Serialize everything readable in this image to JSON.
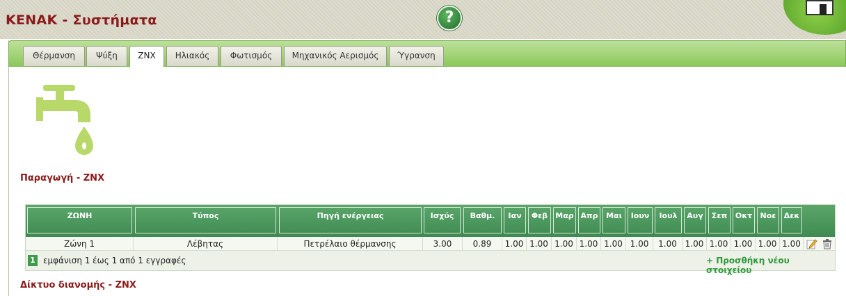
{
  "app": {
    "title": "KENAK - Συστήματα",
    "help_symbol": "?"
  },
  "tabs": [
    {
      "label": "Θέρμανση",
      "active": false
    },
    {
      "label": "Ψύξη",
      "active": false
    },
    {
      "label": "ZNX",
      "active": true
    },
    {
      "label": "Ηλιακός",
      "active": false
    },
    {
      "label": "Φωτισμός",
      "active": false
    },
    {
      "label": "Μηχανικός Αερισμός",
      "active": false
    },
    {
      "label": "Ύγρανση",
      "active": false
    }
  ],
  "section_production": "Παραγωγή - ZNX",
  "section_network": "Δίκτυο διανομής - ZNX",
  "table": {
    "headers": [
      "ΖΩΝΗ",
      "Τύπος",
      "Πηγή ενέργειας",
      "Ισχύς",
      "Βαθμ.",
      "Ιαν",
      "Φεβ",
      "Μαρ",
      "Απρ",
      "Μαι",
      "Ιουν",
      "Ιουλ",
      "Αυγ",
      "Σεπ",
      "Οκτ",
      "Νοε",
      "Δεκ"
    ],
    "rows": [
      [
        "Ζώνη 1",
        "Λέβητας",
        "Πετρέλαιο θέρμανσης",
        "3.00",
        "0.89",
        "1.00",
        "1.00",
        "1.00",
        "1.00",
        "1.00",
        "1.00",
        "1.00",
        "1.00",
        "1.00",
        "1.00",
        "1.00",
        "1.00"
      ]
    ],
    "page": "1",
    "summary": "εμφάνιση 1 έως 1 από 1 εγγραφές",
    "add_label": "+ Προσθήκη νέου στοιχείου"
  },
  "colors": {
    "title": "#8b1a1a",
    "tab_bar": "#8cc85b",
    "grid_header": "#4a9a5c",
    "faucet": "#b9d86a",
    "add_link": "#2e9a3a"
  }
}
